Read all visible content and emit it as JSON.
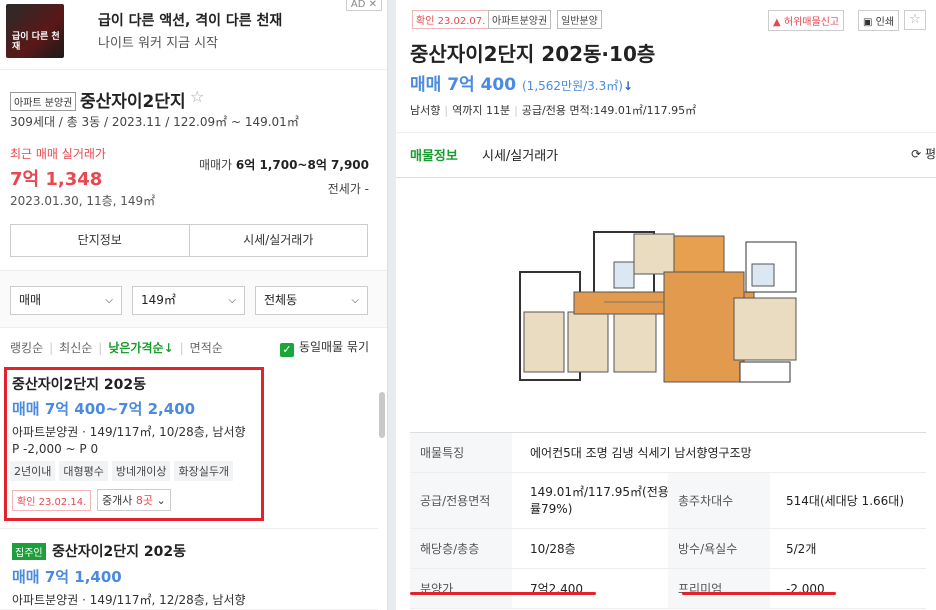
{
  "ad": {
    "title": "급이 다른 액션, 격이 다른 천재",
    "subtitle": "나이트 워커 지금 시작",
    "badge": "AD ✕",
    "thumb_text": "급이 다른 천재"
  },
  "complex": {
    "tag": "아파트 분양권",
    "name": "중산자이2단지",
    "star": "☆",
    "meta": "309세대 / 총 3동 / 2023.11 / 122.09㎡ ~ 149.01㎡",
    "recent_label": "최근 매매 실거래가",
    "recent_price": "7억 1,348",
    "recent_date": "2023.01.30, 11층, 149㎡",
    "sale_label": "매매가",
    "sale_range": "6억 1,700~8억 7,900",
    "jeonse": "전세가 -",
    "buttons": [
      "단지정보",
      "시세/실거래가"
    ]
  },
  "filters": {
    "type": "매매",
    "area": "149㎡",
    "dong": "전체동"
  },
  "sort": {
    "items": [
      "랭킹순",
      "최신순",
      "낮은가격순↓",
      "면적순"
    ],
    "same": "동일매물 묶기"
  },
  "listings": [
    {
      "title": "중산자이2단지 202동",
      "price": "매매 7억 400~7억 2,400",
      "meta": "아파트분양권 · 149/117㎡, 10/28층, 남서향",
      "pp": "P -2,000 ~ P 0",
      "tags": [
        "2년이내",
        "대형평수",
        "방네개이상",
        "화장실두개"
      ],
      "confirm": "확인 23.02.14.",
      "agents": "중개사",
      "agents_count": "8곳",
      "chev": "⌄"
    },
    {
      "owner_tag": "집주인",
      "title": "중산자이2단지 202동",
      "price": "매매 7억 1,400",
      "meta": "아파트분양권 · 149/117㎡, 12/28층, 남서향"
    }
  ],
  "detail": {
    "confirm": "확인 23.02.07.",
    "tag1": "아파트분양권",
    "tag2": "일반분양",
    "report": "허위매물신고",
    "print": "인쇄",
    "title": "중산자이2단지 202동·10층",
    "price": "매매 7억 400",
    "unit": "(1,562만원/3.3㎡)",
    "arrow": "↓",
    "info": [
      "남서향",
      "역까지 11분",
      "공급/전용 면적:149.01㎡/117.95㎡"
    ],
    "tabs": [
      "매물정보",
      "시세/실거래가"
    ],
    "tab_right": "⟳ 평",
    "table": {
      "feature_label": "매물특징",
      "feature": "에어컨5대 조명 김냉 식세기 남서향영구조망",
      "area_label": "공급/전용면적",
      "area": "149.01㎡/117.95㎡(전용률79%)",
      "parking_label": "총주차대수",
      "parking": "514대(세대당 1.66대)",
      "floor_label": "해당층/총층",
      "floor": "10/28층",
      "rooms_label": "방수/욕실수",
      "rooms": "5/2개",
      "presale_label": "분양가",
      "presale": "7억2,400",
      "premium_label": "프리미엄",
      "premium": "-2,000"
    }
  },
  "colors": {
    "accent_green": "#1a9c2e",
    "price_blue": "#4a8ae0",
    "alert_red": "#e8474f"
  }
}
